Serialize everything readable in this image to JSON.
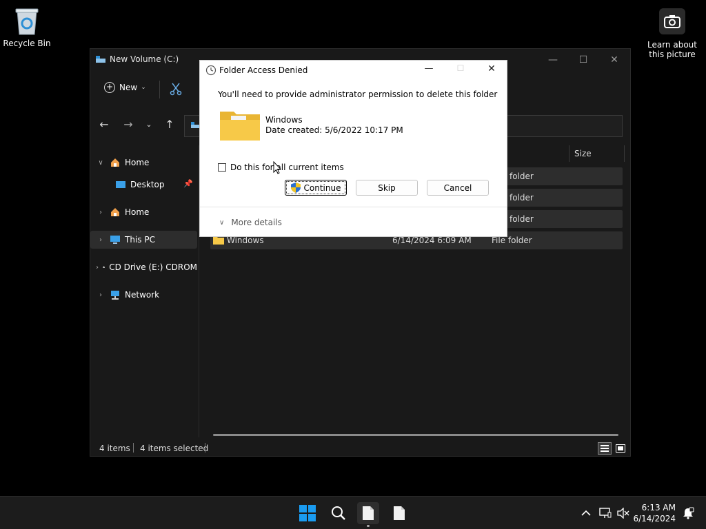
{
  "desktop": {
    "recycle_bin_label": "Recycle Bin",
    "learn_picture_line1": "Learn about",
    "learn_picture_line2": "this picture"
  },
  "explorer": {
    "title": "New Volume (C:)",
    "toolbar": {
      "new_label": "New"
    },
    "sidebar": {
      "items": [
        {
          "label": "Home"
        },
        {
          "label": "Desktop"
        },
        {
          "label": "Home"
        },
        {
          "label": "This PC"
        },
        {
          "label": "CD Drive (E:) CDROM"
        },
        {
          "label": "Network"
        }
      ]
    },
    "columns": {
      "size": "Size"
    },
    "rows": [
      {
        "name": "",
        "date": "",
        "type": "folder"
      },
      {
        "name": "",
        "date": "",
        "type": "folder"
      },
      {
        "name": "",
        "date": "",
        "type": "folder"
      },
      {
        "name": "Windows",
        "date": "6/14/2024 6:09 AM",
        "type": "File folder"
      }
    ],
    "status": {
      "items": "4 items",
      "selected": "4 items selected"
    }
  },
  "dialog": {
    "title": "Folder Access Denied",
    "message": "You'll need to provide administrator permission to delete this folder",
    "folder_name": "Windows",
    "date_created": "Date created: 5/6/2022 10:17 PM",
    "checkbox_label": "Do this for all current items",
    "continue_label": "Continue",
    "skip_label": "Skip",
    "cancel_label": "Cancel",
    "more_details_label": "More details"
  },
  "taskbar": {
    "time": "6:13 AM",
    "date": "6/14/2024"
  },
  "colors": {
    "accent": "#0078d4",
    "folder_yellow": "#f7c948",
    "taskbar_bg": "#1c1c1c",
    "window_bg": "#191919"
  }
}
